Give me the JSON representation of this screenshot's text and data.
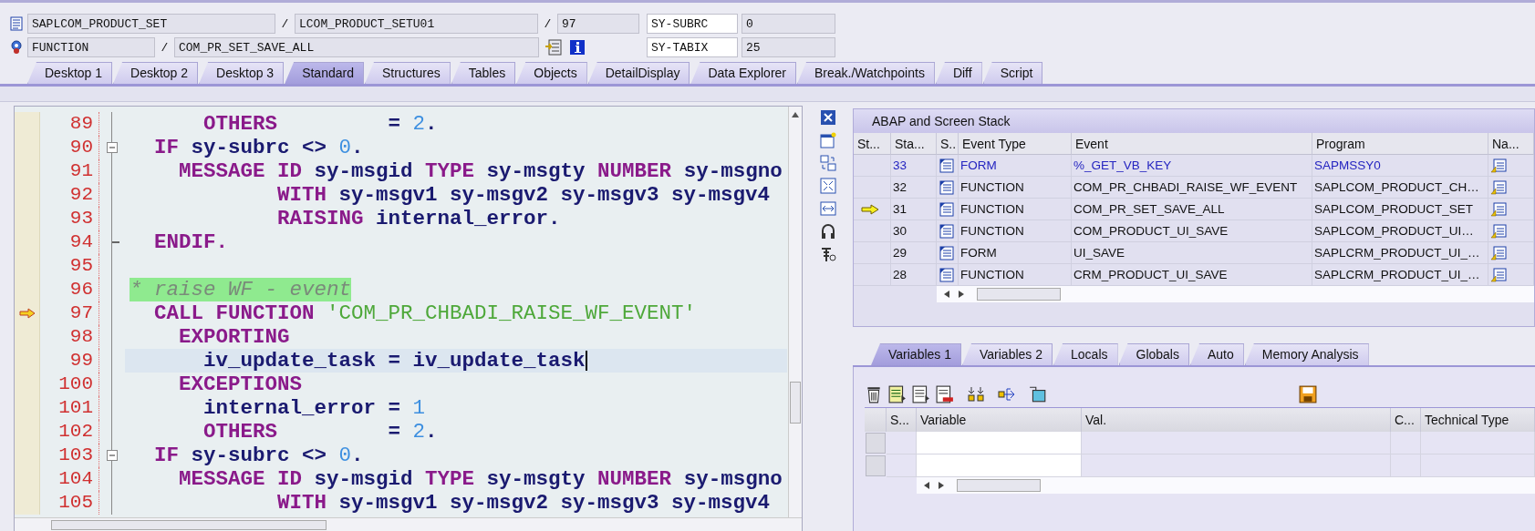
{
  "header": {
    "program": "SAPLCOM_PRODUCT_SET",
    "include": "LCOM_PRODUCT_SETU01",
    "line": "97",
    "event_type": "FUNCTION",
    "event": "COM_PR_SET_SAVE_ALL",
    "separators": [
      "/",
      "/",
      "/"
    ],
    "sy_fields": [
      {
        "name": "SY-SUBRC",
        "value": "0"
      },
      {
        "name": "SY-TABIX",
        "value": "25"
      }
    ]
  },
  "tabs": [
    {
      "label": "Desktop 1",
      "selected": false
    },
    {
      "label": "Desktop 2",
      "selected": false
    },
    {
      "label": "Desktop 3",
      "selected": false
    },
    {
      "label": "Standard",
      "selected": true
    },
    {
      "label": "Structures",
      "selected": false
    },
    {
      "label": "Tables",
      "selected": false
    },
    {
      "label": "Objects",
      "selected": false
    },
    {
      "label": "DetailDisplay",
      "selected": false
    },
    {
      "label": "Data Explorer",
      "selected": false
    },
    {
      "label": "Break./Watchpoints",
      "selected": false
    },
    {
      "label": "Diff",
      "selected": false
    },
    {
      "label": "Script",
      "selected": false
    }
  ],
  "source": {
    "lines": [
      {
        "number": "89",
        "current": false,
        "cursor": false,
        "fold_start": false,
        "fold_end": false,
        "tokens": [
          {
            "kind": "keyword",
            "text": "      OTHERS"
          },
          {
            "kind": "ident",
            "text": "         = "
          },
          {
            "kind": "number",
            "text": "2"
          },
          {
            "kind": "ident",
            "text": "."
          }
        ]
      },
      {
        "number": "90",
        "current": false,
        "cursor": false,
        "fold_start": true,
        "fold_end": false,
        "tokens": [
          {
            "kind": "keyword",
            "text": "  IF"
          },
          {
            "kind": "ident",
            "text": " sy-subrc <> "
          },
          {
            "kind": "number",
            "text": "0"
          },
          {
            "kind": "ident",
            "text": "."
          }
        ]
      },
      {
        "number": "91",
        "current": false,
        "cursor": false,
        "fold_start": false,
        "fold_end": false,
        "tokens": [
          {
            "kind": "keyword",
            "text": "    MESSAGE ID"
          },
          {
            "kind": "ident",
            "text": " sy-msgid "
          },
          {
            "kind": "keyword",
            "text": "TYPE"
          },
          {
            "kind": "ident",
            "text": " sy-msgty "
          },
          {
            "kind": "keyword",
            "text": "NUMBER"
          },
          {
            "kind": "ident",
            "text": " sy-msgno"
          }
        ]
      },
      {
        "number": "92",
        "current": false,
        "cursor": false,
        "fold_start": false,
        "fold_end": false,
        "tokens": [
          {
            "kind": "keyword",
            "text": "            WITH"
          },
          {
            "kind": "ident",
            "text": " sy-msgv1 sy-msgv2 sy-msgv3 sy-msgv4"
          }
        ]
      },
      {
        "number": "93",
        "current": false,
        "cursor": false,
        "fold_start": false,
        "fold_end": false,
        "tokens": [
          {
            "kind": "keyword",
            "text": "            RAISING"
          },
          {
            "kind": "ident",
            "text": " internal_error."
          }
        ]
      },
      {
        "number": "94",
        "current": false,
        "cursor": false,
        "fold_start": false,
        "fold_end": true,
        "tokens": [
          {
            "kind": "keyword",
            "text": "  ENDIF."
          }
        ]
      },
      {
        "number": "95",
        "current": false,
        "cursor": false,
        "fold_start": false,
        "fold_end": false
      },
      {
        "number": "96",
        "current": false,
        "cursor": false,
        "fold_start": false,
        "fold_end": false,
        "tokens": [
          {
            "kind": "comment",
            "text": "* raise WF - event"
          }
        ]
      },
      {
        "number": "97",
        "current": true,
        "cursor": false,
        "fold_start": false,
        "fold_end": false,
        "tokens": [
          {
            "kind": "keyword",
            "text": "  CALL FUNCTION"
          },
          {
            "kind": "string",
            "text": " 'COM_PR_CHBADI_RAISE_WF_EVENT'"
          }
        ]
      },
      {
        "number": "98",
        "current": false,
        "cursor": false,
        "fold_start": false,
        "fold_end": false,
        "tokens": [
          {
            "kind": "keyword",
            "text": "    EXPORTING"
          }
        ]
      },
      {
        "number": "99",
        "current": false,
        "cursor": true,
        "fold_start": false,
        "fold_end": false,
        "tokens": [
          {
            "kind": "ident",
            "text": "      iv_update_task = iv_update_task"
          }
        ]
      },
      {
        "number": "100",
        "current": false,
        "cursor": false,
        "fold_start": false,
        "fold_end": false,
        "tokens": [
          {
            "kind": "keyword",
            "text": "    EXCEPTIONS"
          }
        ]
      },
      {
        "number": "101",
        "current": false,
        "cursor": false,
        "fold_start": false,
        "fold_end": false,
        "tokens": [
          {
            "kind": "ident",
            "text": "      internal_error = "
          },
          {
            "kind": "number",
            "text": "1"
          }
        ]
      },
      {
        "number": "102",
        "current": false,
        "cursor": false,
        "fold_start": false,
        "fold_end": false,
        "tokens": [
          {
            "kind": "keyword",
            "text": "      OTHERS"
          },
          {
            "kind": "ident",
            "text": "         = "
          },
          {
            "kind": "number",
            "text": "2"
          },
          {
            "kind": "ident",
            "text": "."
          }
        ]
      },
      {
        "number": "103",
        "current": false,
        "cursor": false,
        "fold_start": true,
        "fold_end": false,
        "tokens": [
          {
            "kind": "keyword",
            "text": "  IF"
          },
          {
            "kind": "ident",
            "text": " sy-subrc <> "
          },
          {
            "kind": "number",
            "text": "0"
          },
          {
            "kind": "ident",
            "text": "."
          }
        ]
      },
      {
        "number": "104",
        "current": false,
        "cursor": false,
        "fold_start": false,
        "fold_end": false,
        "tokens": [
          {
            "kind": "keyword",
            "text": "    MESSAGE ID"
          },
          {
            "kind": "ident",
            "text": " sy-msgid "
          },
          {
            "kind": "keyword",
            "text": "TYPE"
          },
          {
            "kind": "ident",
            "text": " sy-msgty "
          },
          {
            "kind": "keyword",
            "text": "NUMBER"
          },
          {
            "kind": "ident",
            "text": " sy-msgno"
          }
        ]
      },
      {
        "number": "105",
        "current": false,
        "cursor": false,
        "fold_start": false,
        "fold_end": false,
        "tokens": [
          {
            "kind": "keyword",
            "text": "            WITH"
          },
          {
            "kind": "ident",
            "text": " sy-msgv1 sy-msgv2 sy-msgv3 sy-msgv4"
          }
        ]
      }
    ]
  },
  "stack": {
    "title": "ABAP and Screen Stack",
    "columns": [
      "St...",
      "Sta...",
      "S..",
      "Event Type",
      "Event",
      "Program",
      "Na..."
    ],
    "rows": [
      {
        "stack_level": "33",
        "event_type": "FORM",
        "event": "%_GET_VB_KEY",
        "program": "SAPMSSY0",
        "current": false,
        "highlighted": true
      },
      {
        "stack_level": "32",
        "event_type": "FUNCTION",
        "event": "COM_PR_CHBADI_RAISE_WF_EVENT",
        "program": "SAPLCOM_PRODUCT_CH…",
        "current": false,
        "highlighted": false
      },
      {
        "stack_level": "31",
        "event_type": "FUNCTION",
        "event": "COM_PR_SET_SAVE_ALL",
        "program": "SAPLCOM_PRODUCT_SET",
        "current": true,
        "highlighted": false
      },
      {
        "stack_level": "30",
        "event_type": "FUNCTION",
        "event": "COM_PRODUCT_UI_SAVE",
        "program": "SAPLCOM_PRODUCT_UI…",
        "current": false,
        "highlighted": false
      },
      {
        "stack_level": "29",
        "event_type": "FORM",
        "event": "UI_SAVE",
        "program": "SAPLCRM_PRODUCT_UI_…",
        "current": false,
        "highlighted": false
      },
      {
        "stack_level": "28",
        "event_type": "FUNCTION",
        "event": "CRM_PRODUCT_UI_SAVE",
        "program": "SAPLCRM_PRODUCT_UI_…",
        "current": false,
        "highlighted": false
      }
    ]
  },
  "variables": {
    "tabs": [
      {
        "label": "Variables 1",
        "selected": true
      },
      {
        "label": "Variables 2",
        "selected": false
      },
      {
        "label": "Locals",
        "selected": false
      },
      {
        "label": "Globals",
        "selected": false
      },
      {
        "label": "Auto",
        "selected": false
      },
      {
        "label": "Memory Analysis",
        "selected": false
      }
    ],
    "columns": [
      "S...",
      "Variable",
      "Val.",
      "C...",
      "Technical Type"
    ]
  }
}
